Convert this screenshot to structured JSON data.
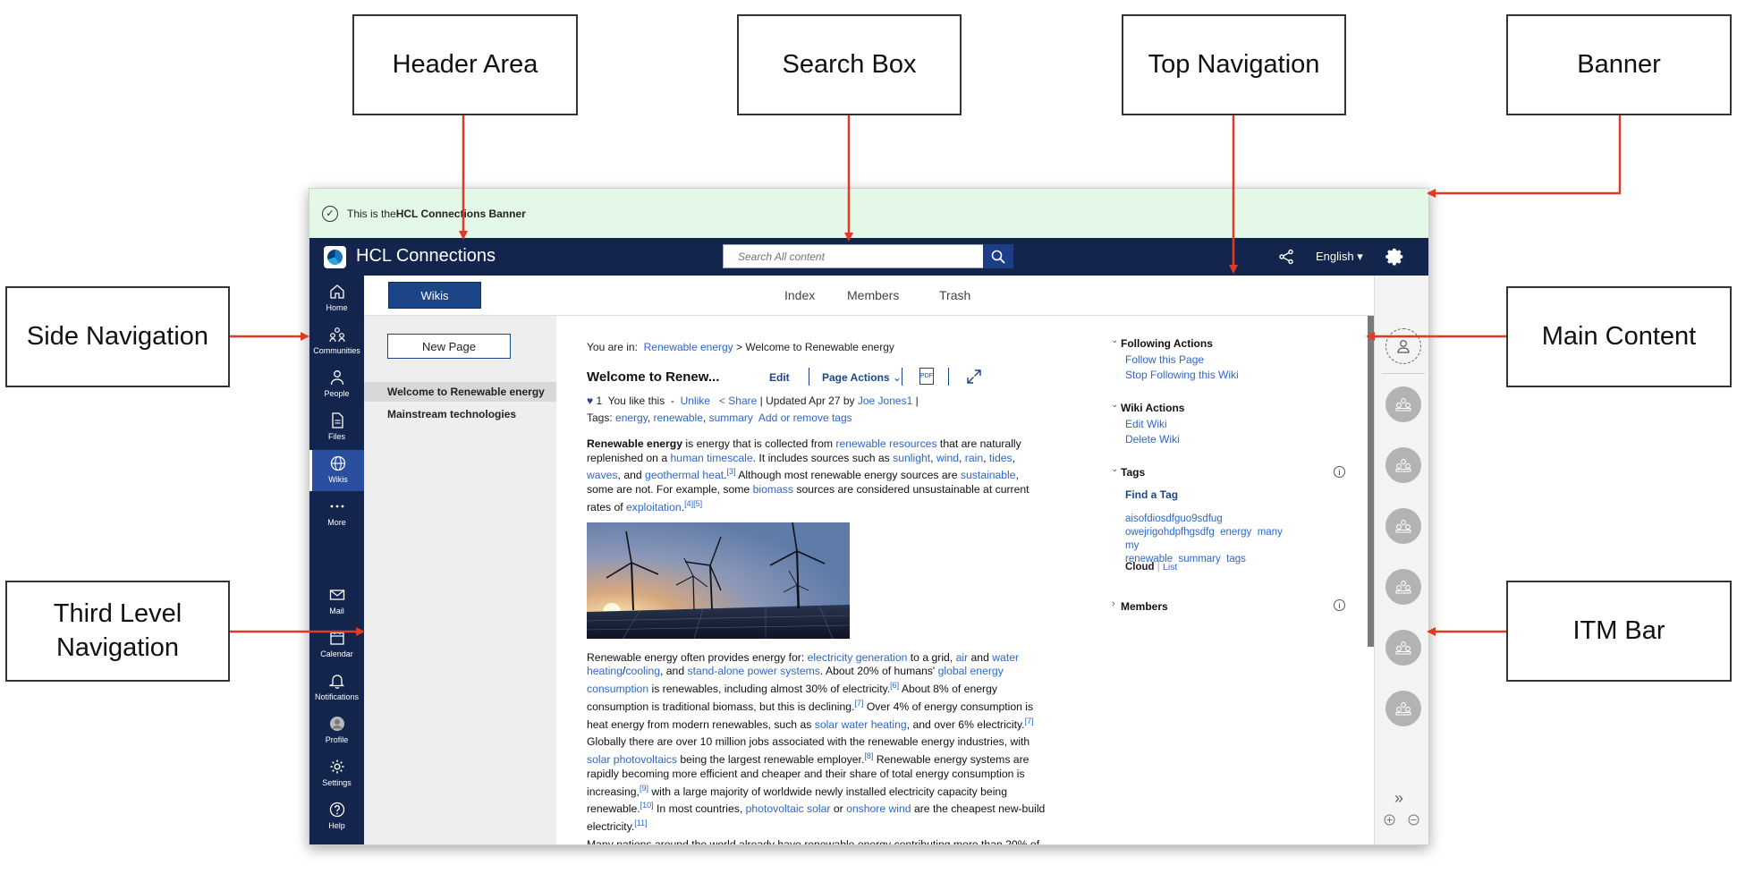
{
  "callouts": {
    "header_area": "Header Area",
    "search_box": "Search Box",
    "top_navigation": "Top Navigation",
    "banner": "Banner",
    "side_navigation": "Side Navigation",
    "main_content": "Main Content",
    "third_level_navigation": "Third Level Navigation",
    "itm_bar": "ITM Bar"
  },
  "colors": {
    "header_bg": "#13254c",
    "banner_bg": "#e4f8e8",
    "arrow": "#e03a24",
    "link": "#2f67c4",
    "accent": "#1c4587"
  },
  "banner": {
    "prefix": "This is the ",
    "bold": "HCL Connections Banner"
  },
  "header": {
    "app_name": "HCL Connections",
    "search_placeholder": "Search All content",
    "language": "English",
    "icons": [
      "share-icon",
      "gear-icon",
      "search-icon"
    ]
  },
  "side_nav": [
    {
      "label": "Home",
      "icon": "home-icon"
    },
    {
      "label": "Communities",
      "icon": "communities-icon"
    },
    {
      "label": "People",
      "icon": "person-icon"
    },
    {
      "label": "Files",
      "icon": "file-icon"
    },
    {
      "label": "Wikis",
      "icon": "globe-icon",
      "active": true
    },
    {
      "label": "More",
      "icon": "ellipsis-icon"
    },
    {
      "label": "Mail",
      "icon": "mail-icon"
    },
    {
      "label": "Calendar",
      "icon": "calendar-icon"
    },
    {
      "label": "Notifications",
      "icon": "bell-icon"
    },
    {
      "label": "Profile",
      "icon": "avatar-icon"
    },
    {
      "label": "Settings",
      "icon": "gear-icon"
    },
    {
      "label": "Help",
      "icon": "help-icon"
    }
  ],
  "top_nav": {
    "button": "Wikis",
    "links": [
      "Index",
      "Members",
      "Trash"
    ]
  },
  "third_nav": {
    "new_page": "New Page",
    "items": [
      "Welcome to Renewable energy",
      "Mainstream technologies"
    ]
  },
  "main": {
    "breadcrumb_prefix": "You are in:",
    "breadcrumb_link": "Renewable energy",
    "breadcrumb_rest": " > Welcome to Renewable energy",
    "title": "Welcome to Renew...",
    "actions": {
      "edit": "Edit",
      "page_actions": "Page Actions",
      "pdf": "PDF"
    },
    "meta": {
      "likes": "1",
      "you_like": "You like this",
      "sep": "-",
      "unlike": "Unlike",
      "share": "Share",
      "updated": "| Updated Apr 27 by",
      "author": "Joe Jones1",
      "end": "|"
    },
    "tags_label": "Tags:",
    "tags": [
      "energy",
      "renewable",
      "summary"
    ],
    "tags_edit": "Add or remove tags",
    "body_intro_html_parts": {
      "p1_bold": "Renewable energy",
      "p1_a": " is energy that is collected from ",
      "p1_l1": "renewable resources",
      "p1_b": " that are naturally replenished on a ",
      "p1_l2": "human timescale",
      "p1_c": ". It includes sources such as ",
      "p1_l3": "sunlight",
      "p1_l4": "wind",
      "p1_l5": "rain",
      "p1_l6": "tides",
      "p1_l7": "waves",
      "p1_d": ", and ",
      "p1_l8": "geothermal heat",
      "p1_s1": "[3]",
      "p1_e": " Although most renewable energy sources are ",
      "p1_l9": "sustainable",
      "p1_f": ", some are not. For example, some ",
      "p1_l10": "biomass",
      "p1_g": " sources are considered unsustainable at current rates of ",
      "p1_l11": "exploitation",
      "p1_s2": "[4][5]"
    },
    "body_p2": {
      "a": "Renewable energy often provides energy for: ",
      "l1": "electricity generation",
      "b": " to a grid, ",
      "l2": "air",
      "c": " and ",
      "l3": "water heating",
      "d": "/",
      "l4": "cooling",
      "e": ", and ",
      "l5": "stand-alone power systems",
      "f": ". About 20% of humans' ",
      "l6": "global energy consumption",
      "g": " is renewables, including almost 30% of electricity.",
      "s1": "[6]",
      "h": " About 8% of energy consumption is traditional biomass, but this is declining.",
      "s2": "[7]",
      "i": " Over 4% of energy consumption is heat energy from modern renewables, such as ",
      "l7": "solar water heating",
      "j": ", and over 6% electricity.",
      "s3": "[7]"
    },
    "body_p3": {
      "a": "Globally there are over 10 million jobs associated with the renewable energy industries, with ",
      "l1": "solar photovoltaics",
      "b": " being the largest renewable employer.",
      "s1": "[8]",
      "c": " Renewable energy systems are rapidly becoming more efficient and cheaper and their share of total energy consumption is increasing,",
      "s2": "[9]",
      "d": " with a large majority of worldwide newly installed electricity capacity being renewable.",
      "s3": "[10]",
      "e": " In most countries, ",
      "l2": "photovoltaic solar",
      "f": " or ",
      "l3": "onshore wind",
      "g": " are the cheapest new-build electricity.",
      "s4": "[11]"
    },
    "body_p4": "Many nations around the world already have renewable energy contributing more than 20% of"
  },
  "right_col": {
    "following": {
      "title": "Following Actions",
      "links": [
        "Follow this Page",
        "Stop Following this Wiki"
      ]
    },
    "wiki_actions": {
      "title": "Wiki Actions",
      "links": [
        "Edit Wiki",
        "Delete Wiki"
      ]
    },
    "tags": {
      "title": "Tags",
      "find": "Find a Tag",
      "cloud": [
        "aisofdiosdfguo9sdfug",
        "owejrigohdpfhgsdfg",
        "energy",
        "many",
        "my",
        "renewable",
        "summary",
        "tags"
      ],
      "view_cloud": "Cloud",
      "view_sep": "|",
      "view_list": "List"
    },
    "members": {
      "title": "Members"
    }
  }
}
